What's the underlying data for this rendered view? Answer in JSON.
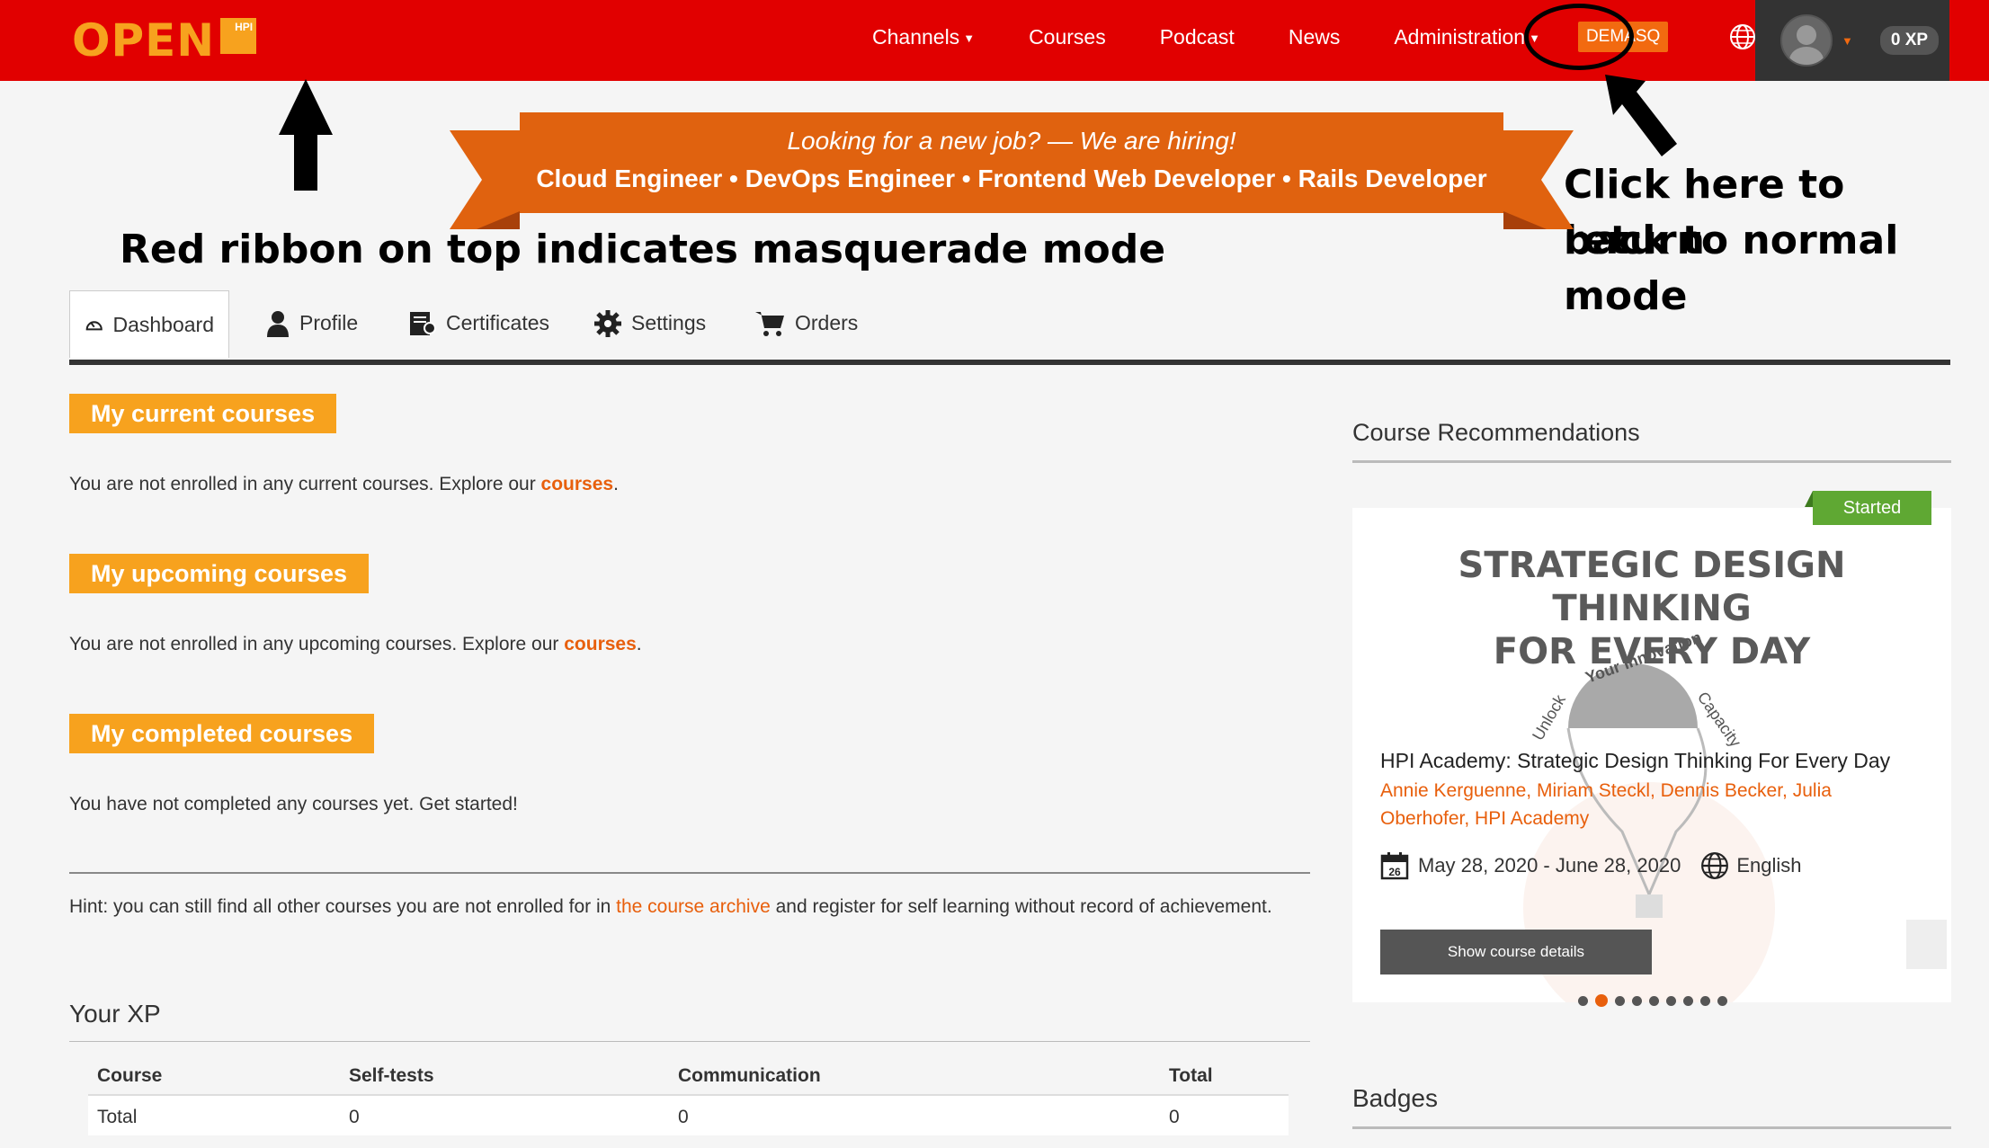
{
  "navbar": {
    "logo_text": "OPEN",
    "logo_badge": "HPI",
    "items": [
      {
        "label": "Channels",
        "caret": true
      },
      {
        "label": "Courses",
        "caret": false
      },
      {
        "label": "Podcast",
        "caret": false
      },
      {
        "label": "News",
        "caret": false
      },
      {
        "label": "Administration",
        "caret": true
      }
    ],
    "masquerade_label": "DEMASQ",
    "language": "EN",
    "xp": "0 XP",
    "bg_color": "#e10000"
  },
  "annotations": {
    "ribbon_note": "Red ribbon on top indicates masquerade mode",
    "return_note_line1": "Click here to return",
    "return_note_line2": "back to normal mode"
  },
  "hiring_banner": {
    "line1": "Looking for a new job? — We are hiring!",
    "line2": "Cloud Engineer • DevOps Engineer • Frontend Web Developer • Rails Developer",
    "color": "#e0620f"
  },
  "tabs": [
    {
      "label": "Dashboard",
      "icon": "gauge-icon"
    },
    {
      "label": "Profile",
      "icon": "user-icon"
    },
    {
      "label": "Certificates",
      "icon": "certificate-icon"
    },
    {
      "label": "Settings",
      "icon": "gear-icon"
    },
    {
      "label": "Orders",
      "icon": "cart-icon"
    }
  ],
  "sections": {
    "current": {
      "title": "My current courses",
      "text_before": "You are not enrolled in any current courses. Explore our ",
      "link": "courses",
      "text_after": "."
    },
    "upcoming": {
      "title": "My upcoming courses",
      "text_before": "You are not enrolled in any upcoming courses. Explore our ",
      "link": "courses",
      "text_after": "."
    },
    "completed": {
      "title": "My completed courses",
      "text": "You have not completed any courses yet. Get started!"
    },
    "hint": {
      "text_before": "Hint: you can still find all other courses you are not enrolled for in ",
      "link": "the course archive",
      "text_after": " and register for self learning without record of achievement."
    }
  },
  "xp": {
    "heading": "Your XP",
    "columns": [
      "Course",
      "Self-tests",
      "Communication",
      "Total"
    ],
    "rows": [
      [
        "Total",
        "0",
        "0",
        "0"
      ]
    ]
  },
  "recommendations": {
    "heading": "Course Recommendations",
    "badge": "Started",
    "card_title_line1": "STRATEGIC DESIGN THINKING",
    "card_title_line2": "FOR EVERY DAY",
    "course_title": "HPI Academy: Strategic Design Thinking For Every Day",
    "teachers": "Annie Kerguenne, Miriam Steckl, Dennis Becker, Julia Oberhofer, HPI Academy",
    "date_range": "May 28, 2020 - June 28, 2020",
    "calendar_day": "26",
    "language": "English",
    "button": "Show course details",
    "dots_count": 9,
    "active_dot": 1
  },
  "badges": {
    "heading": "Badges"
  }
}
